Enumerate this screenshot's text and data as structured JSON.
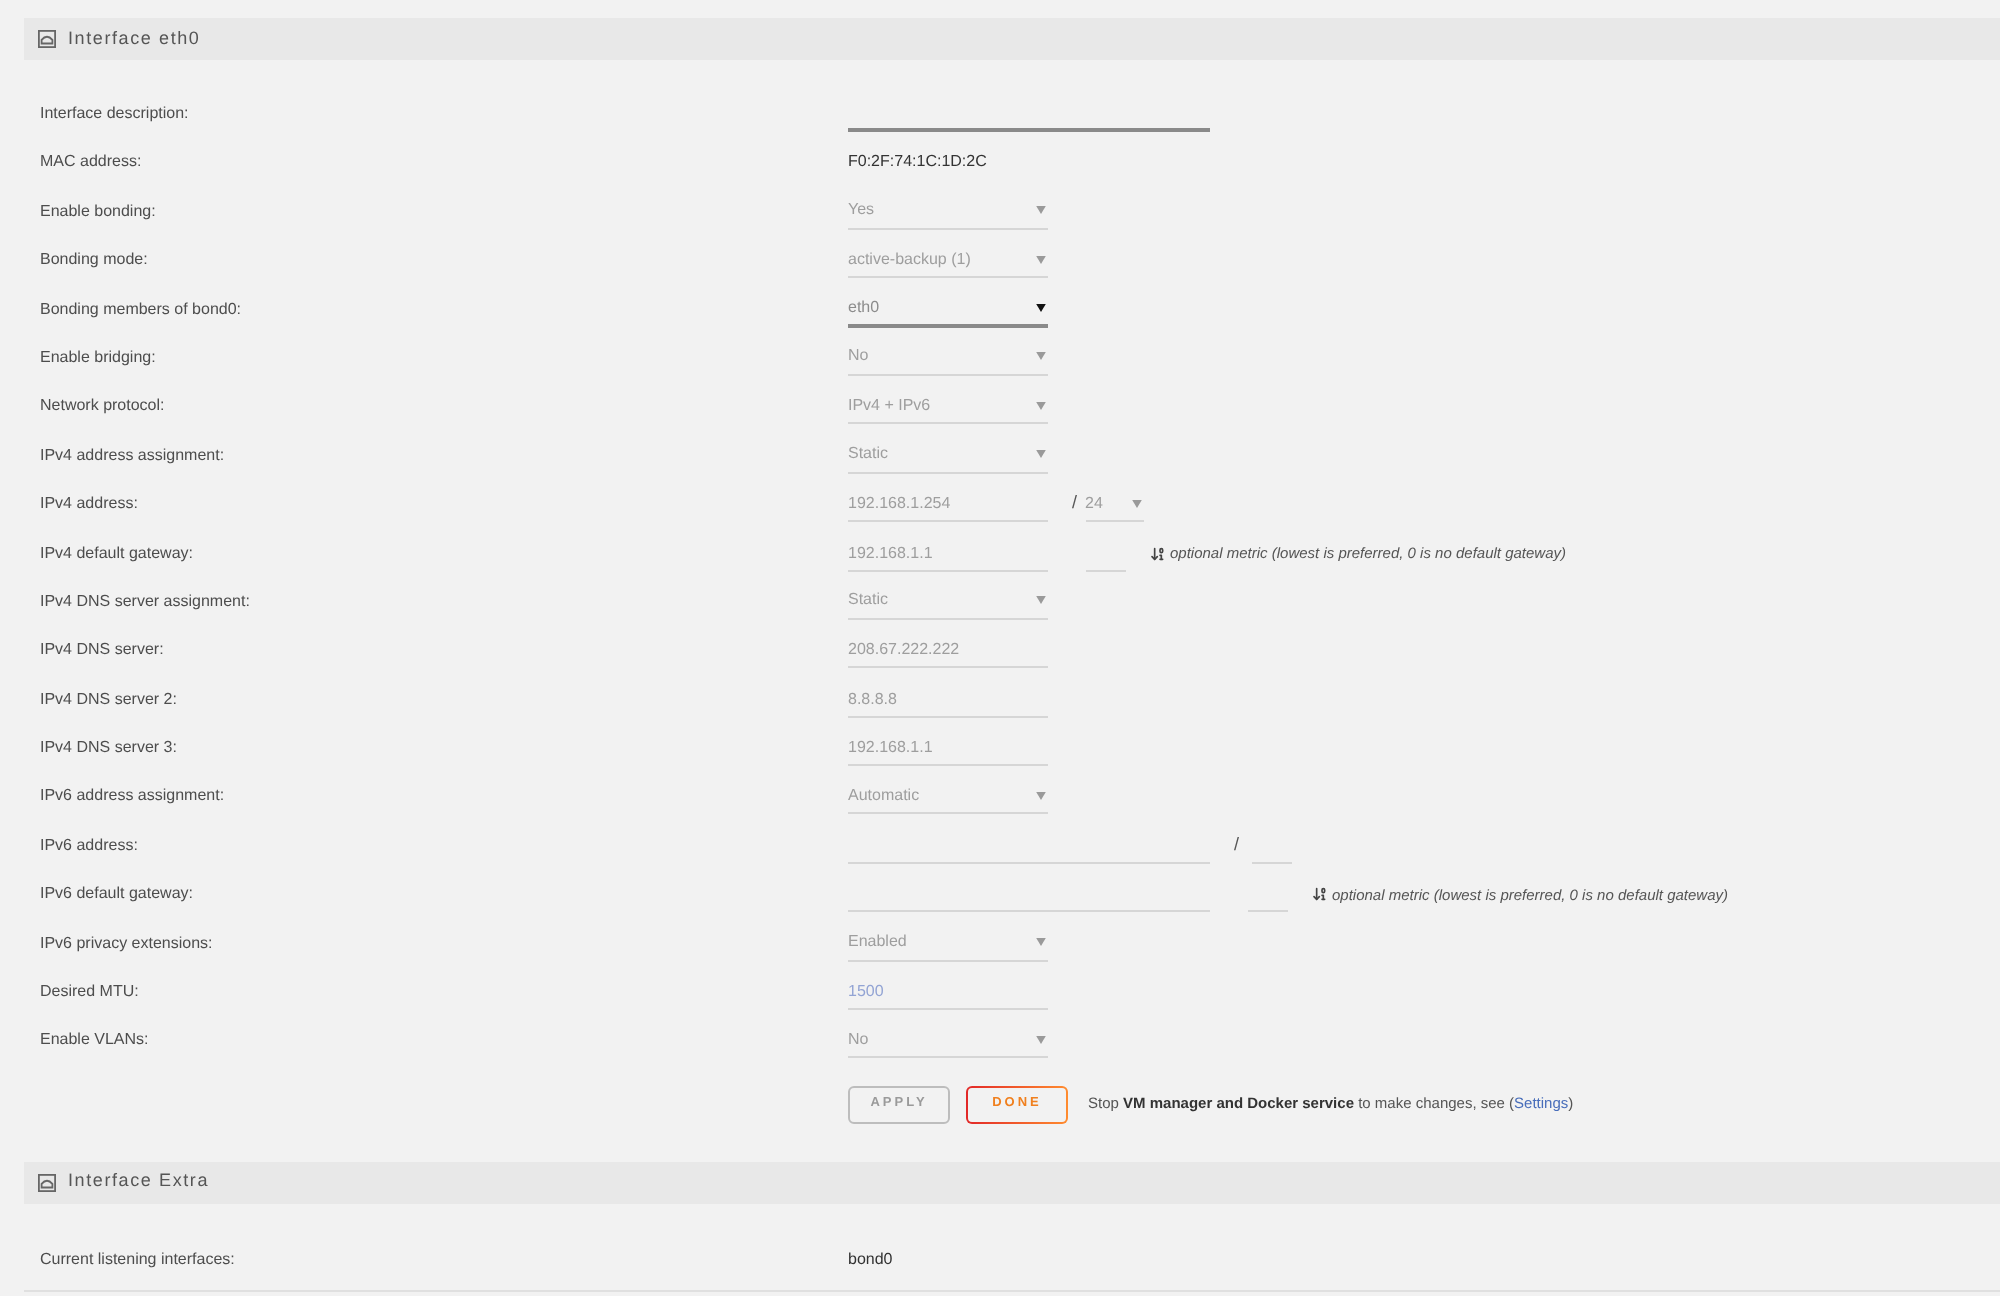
{
  "sections": [
    {
      "title": "Interface eth0",
      "rows": [
        {
          "label": "Interface description:",
          "controls": [
            {
              "kind": "wide-input",
              "disabled": false
            }
          ]
        },
        {
          "label": "MAC address:",
          "controls": [
            {
              "kind": "text",
              "value": "F0:2F:74:1C:1D:2C"
            }
          ]
        },
        {
          "label": "Enable bonding:",
          "controls": [
            {
              "kind": "select",
              "value": "Yes",
              "disabled": true
            }
          ]
        },
        {
          "label": "Bonding mode:",
          "controls": [
            {
              "kind": "select",
              "value": "active-backup (1)",
              "disabled": true
            }
          ]
        },
        {
          "label": "Bonding members of bond0:",
          "controls": [
            {
              "kind": "select",
              "value": "eth0",
              "disabled": false
            }
          ]
        },
        {
          "label": "Enable bridging:",
          "controls": [
            {
              "kind": "select",
              "value": "No",
              "disabled": true
            }
          ]
        },
        {
          "label": "Network protocol:",
          "controls": [
            {
              "kind": "select",
              "value": "IPv4 + IPv6",
              "disabled": true
            }
          ]
        },
        {
          "label": "IPv4 address assignment:",
          "controls": [
            {
              "kind": "select",
              "value": "Static",
              "disabled": true
            }
          ]
        },
        {
          "label": "IPv4 address:",
          "controls": [
            {
              "kind": "input",
              "value": "192.168.1.254",
              "disabled": true
            },
            {
              "kind": "separator",
              "text": "/"
            },
            {
              "kind": "small-select",
              "value": "24",
              "disabled": true
            }
          ]
        },
        {
          "label": "IPv4 default gateway:",
          "controls": [
            {
              "kind": "input",
              "value": "192.168.1.1",
              "disabled": true
            },
            {
              "kind": "small-input",
              "disabled": true
            },
            {
              "kind": "hint",
              "text": "optional metric (lowest is preferred, 0 is no default gateway)"
            }
          ]
        },
        {
          "label": "IPv4 DNS server assignment:",
          "controls": [
            {
              "kind": "select",
              "value": "Static",
              "disabled": true
            }
          ]
        },
        {
          "label": "IPv4 DNS server:",
          "controls": [
            {
              "kind": "input",
              "value": "208.67.222.222",
              "disabled": true
            }
          ]
        },
        {
          "label": "IPv4 DNS server 2:",
          "controls": [
            {
              "kind": "input",
              "value": "8.8.8.8",
              "disabled": true
            }
          ]
        },
        {
          "label": "IPv4 DNS server 3:",
          "controls": [
            {
              "kind": "input",
              "value": "192.168.1.1",
              "disabled": true
            }
          ]
        },
        {
          "label": "IPv6 address assignment:",
          "controls": [
            {
              "kind": "select",
              "value": "Automatic",
              "disabled": true
            }
          ]
        },
        {
          "label": "IPv6 address:",
          "controls": [
            {
              "kind": "wide-input",
              "disabled": true
            },
            {
              "kind": "separator",
              "text": "/"
            },
            {
              "kind": "small-input",
              "disabled": true
            }
          ]
        },
        {
          "label": "IPv6 default gateway:",
          "controls": [
            {
              "kind": "wide-input",
              "disabled": true
            },
            {
              "kind": "small-input",
              "disabled": true
            },
            {
              "kind": "hint",
              "text": "optional metric (lowest is preferred, 0 is no default gateway)"
            }
          ]
        },
        {
          "label": "IPv6 privacy extensions:",
          "controls": [
            {
              "kind": "select",
              "value": "Enabled",
              "disabled": true
            }
          ]
        },
        {
          "label": "Desired MTU:",
          "controls": [
            {
              "kind": "input",
              "placeholder": "1500",
              "disabled": true
            }
          ]
        },
        {
          "label": "Enable VLANs:",
          "controls": [
            {
              "kind": "select",
              "value": "No",
              "disabled": true
            }
          ]
        }
      ],
      "buttons": [
        {
          "label": "APPLY",
          "kind": "apply",
          "disabled": true
        },
        {
          "label": "DONE",
          "kind": "done",
          "disabled": false
        }
      ],
      "note": {
        "text": "Stop **VM manager and Docker service** to make changes, see (",
        "link": "Settings",
        "after": ")"
      }
    },
    {
      "title": "Interface Extra",
      "rows": [
        {
          "label": "Current listening interfaces:",
          "controls": [
            {
              "kind": "text",
              "value": "bond0"
            }
          ]
        }
      ]
    }
  ]
}
